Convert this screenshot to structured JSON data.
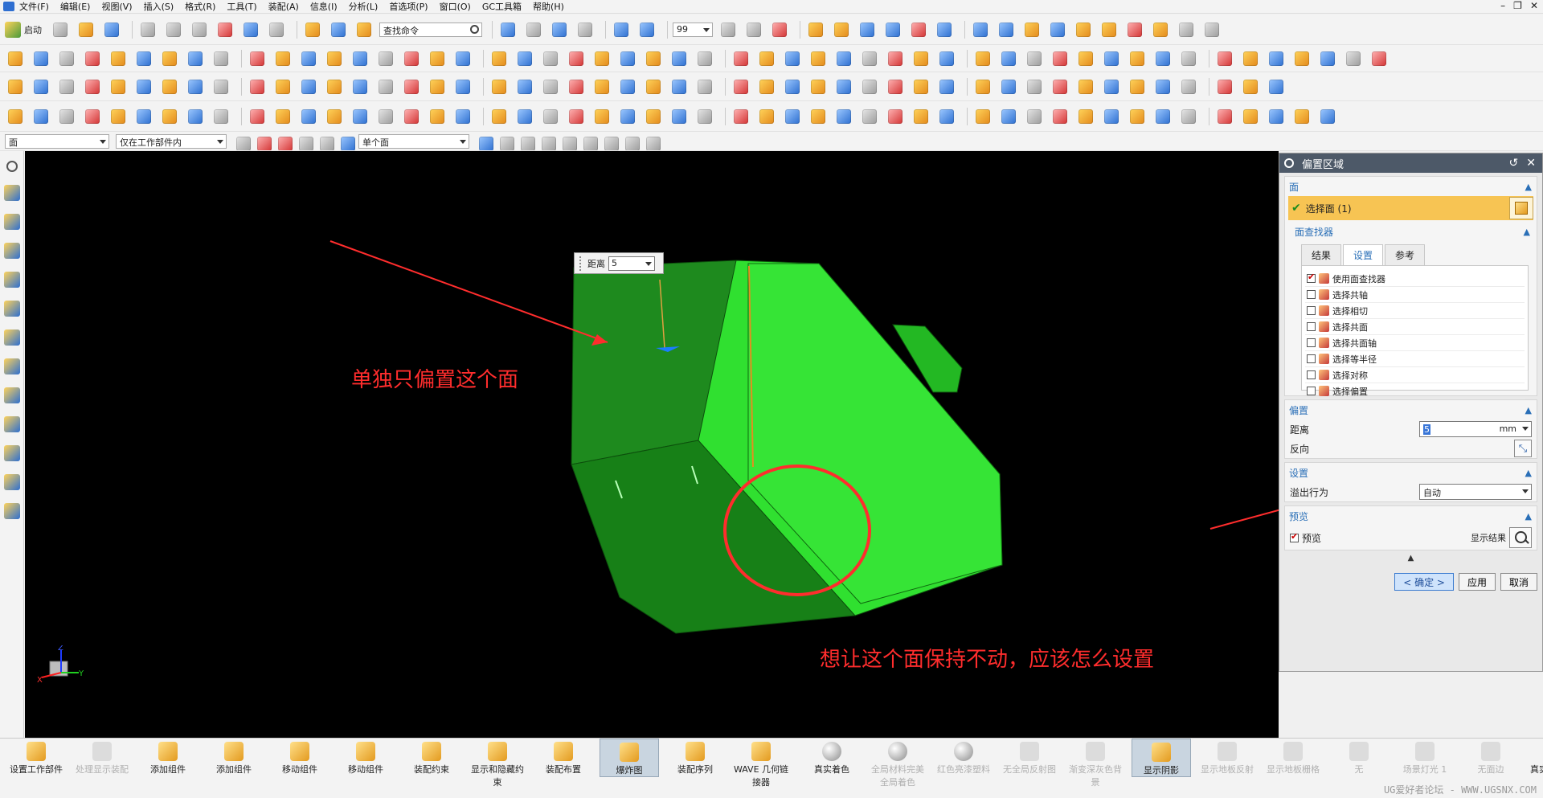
{
  "menu": [
    "文件(F)",
    "编辑(E)",
    "视图(V)",
    "插入(S)",
    "格式(R)",
    "工具(T)",
    "装配(A)",
    "信息(I)",
    "分析(L)",
    "首选项(P)",
    "窗口(O)",
    "GC工具箱",
    "帮助(H)"
  ],
  "toolbar": {
    "start_label": "启动",
    "search_placeholder": "查找命令",
    "layer_value": "99"
  },
  "selection_bar": {
    "type_filter": "面",
    "scope": "仅在工作部件内",
    "face_rule": "单个面"
  },
  "viewport": {
    "distance_label": "距离",
    "distance_value": "5",
    "annotation_1": "单独只偏置这个面",
    "annotation_2": "想让这个面保持不动，应该怎么设置",
    "annotation_color": "#ff2d2d",
    "model_color": "#22d62a",
    "triad_z": "Z",
    "triad_x": "X",
    "triad_y": "Y"
  },
  "dialog": {
    "title": "偏置区域",
    "face_group": "面",
    "select_face": "选择面 (1)",
    "face_finder": "面查找器",
    "tabs": [
      "结果",
      "设置",
      "参考"
    ],
    "active_tab": "设置",
    "finder_items": [
      {
        "label": "使用面查找器",
        "checked": true
      },
      {
        "label": "选择共轴",
        "checked": false
      },
      {
        "label": "选择相切",
        "checked": false
      },
      {
        "label": "选择共面",
        "checked": false
      },
      {
        "label": "选择共面轴",
        "checked": false
      },
      {
        "label": "选择等半径",
        "checked": false
      },
      {
        "label": "选择对称",
        "checked": false
      },
      {
        "label": "选择偏置",
        "checked": false
      }
    ],
    "offset_group": "偏置",
    "distance_label": "距离",
    "distance_value": "5",
    "distance_unit": "mm",
    "reverse_label": "反向",
    "settings_group": "设置",
    "overflow_label": "溢出行为",
    "overflow_value": "自动",
    "preview_group": "预览",
    "preview_label": "预览",
    "preview_checked": true,
    "show_result_label": "显示结果",
    "ok_label": "< 确定 >",
    "apply_label": "应用",
    "cancel_label": "取消"
  },
  "bottom_bar": [
    {
      "label": "设置工作部件",
      "disabled": false,
      "active": false,
      "icon": "work-part-icon"
    },
    {
      "label": "处理显示装配",
      "disabled": true,
      "active": false,
      "icon": "display-assembly-icon"
    },
    {
      "label": "添加组件",
      "disabled": false,
      "active": false,
      "icon": "add-component-icon"
    },
    {
      "label": "添加组件",
      "disabled": false,
      "active": false,
      "icon": "add-component-icon"
    },
    {
      "label": "移动组件",
      "disabled": false,
      "active": false,
      "icon": "move-component-icon"
    },
    {
      "label": "移动组件",
      "disabled": false,
      "active": false,
      "icon": "move-component-icon"
    },
    {
      "label": "装配约束",
      "disabled": false,
      "active": false,
      "icon": "constraint-icon"
    },
    {
      "label": "显示和隐藏约束",
      "disabled": false,
      "active": false,
      "icon": "show-hide-constraint-icon"
    },
    {
      "label": "装配布置",
      "disabled": false,
      "active": false,
      "icon": "arrangement-icon"
    },
    {
      "label": "爆炸图",
      "disabled": false,
      "active": true,
      "icon": "exploded-view-icon"
    },
    {
      "label": "装配序列",
      "disabled": false,
      "active": false,
      "icon": "sequence-icon"
    },
    {
      "label": "WAVE 几何链接器",
      "disabled": false,
      "active": false,
      "icon": "wave-linker-icon"
    },
    {
      "label": "真实着色",
      "disabled": false,
      "active": false,
      "icon": "true-shading-icon"
    },
    {
      "label": "全局材料完美全局着色",
      "disabled": true,
      "active": false,
      "icon": "global-material-icon"
    },
    {
      "label": "红色亮漆塑料",
      "disabled": true,
      "active": false,
      "icon": "material-icon"
    },
    {
      "label": "无全局反射图",
      "disabled": true,
      "active": false,
      "icon": "reflection-icon"
    },
    {
      "label": "渐变深灰色背景",
      "disabled": true,
      "active": false,
      "icon": "background-icon"
    },
    {
      "label": "显示阴影",
      "disabled": false,
      "active": true,
      "icon": "shadow-icon"
    },
    {
      "label": "显示地板反射",
      "disabled": true,
      "active": false,
      "icon": "floor-reflection-icon"
    },
    {
      "label": "显示地板栅格",
      "disabled": true,
      "active": false,
      "icon": "floor-grid-icon"
    },
    {
      "label": "无",
      "disabled": true,
      "active": false,
      "icon": "none-icon"
    },
    {
      "label": "场景灯光 1",
      "disabled": true,
      "active": false,
      "icon": "scene-light-icon"
    },
    {
      "label": "无面边",
      "disabled": true,
      "active": false,
      "icon": "face-edge-icon"
    },
    {
      "label": "真实着色编辑器",
      "disabled": false,
      "active": false,
      "icon": "shading-editor-icon"
    }
  ],
  "watermark": "UG爱好者论坛 - WWW.UGSNX.COM"
}
